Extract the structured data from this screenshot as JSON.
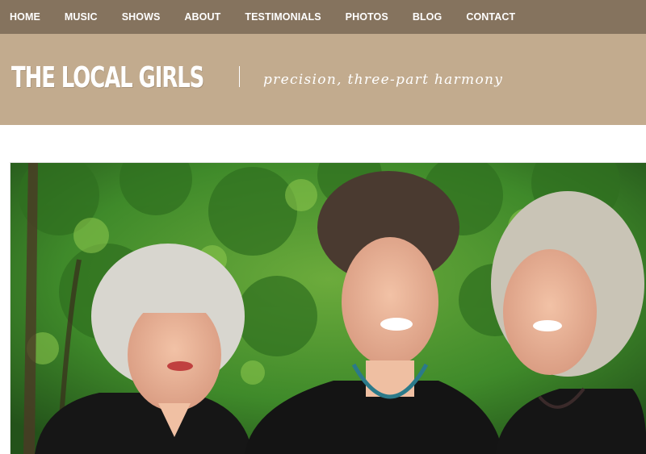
{
  "nav": {
    "items": [
      {
        "label": "HOME"
      },
      {
        "label": "MUSIC"
      },
      {
        "label": "SHOWS"
      },
      {
        "label": "ABOUT"
      },
      {
        "label": "TESTIMONIALS"
      },
      {
        "label": "PHOTOS"
      },
      {
        "label": "BLOG"
      },
      {
        "label": "CONTACT"
      }
    ]
  },
  "header": {
    "title": "THE LOCAL GIRLS",
    "tagline": "precision, three-part harmony"
  },
  "colors": {
    "nav_bg": "#85735e",
    "banner_bg": "#c2ab8e",
    "foliage": "#3f8a2a"
  }
}
